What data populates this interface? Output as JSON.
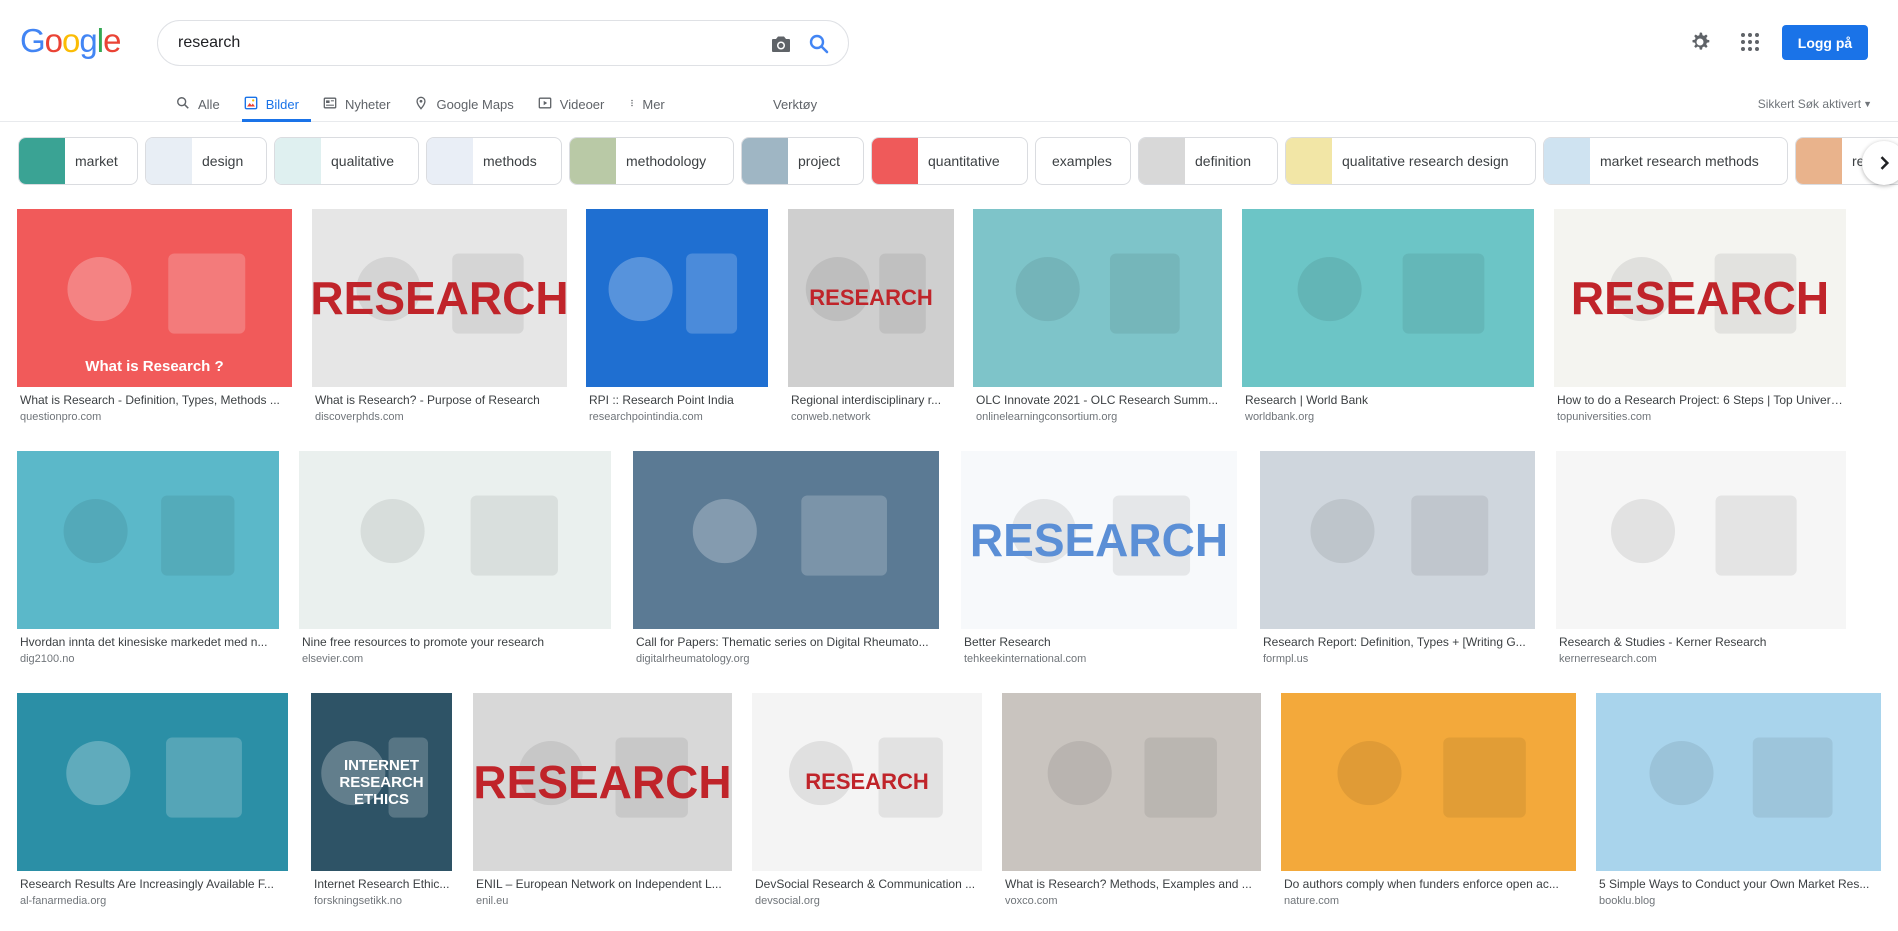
{
  "search": {
    "query": "research"
  },
  "logo": {
    "text": [
      "G",
      "o",
      "o",
      "g",
      "l",
      "e"
    ],
    "colors": [
      "#4285f4",
      "#ea4335",
      "#fbbc05",
      "#4285f4",
      "#34a853",
      "#ea4335"
    ]
  },
  "header": {
    "login_label": "Logg på"
  },
  "tabs": [
    {
      "label": "Alle",
      "icon": "search-icon",
      "active": false
    },
    {
      "label": "Bilder",
      "icon": "image-icon",
      "active": true
    },
    {
      "label": "Nyheter",
      "icon": "news-icon",
      "active": false
    },
    {
      "label": "Google Maps",
      "icon": "map-pin-icon",
      "active": false
    },
    {
      "label": "Videoer",
      "icon": "video-icon",
      "active": false
    },
    {
      "label": "Mer",
      "icon": "more-vert-icon",
      "active": false
    }
  ],
  "tools_label": "Verktøy",
  "safe_search_label": "Sikkert Søk aktivert",
  "chips": [
    {
      "label": "market",
      "color": "#3aa394"
    },
    {
      "label": "design",
      "color": "#e8eef5"
    },
    {
      "label": "qualitative",
      "color": "#dff0f0"
    },
    {
      "label": "methods",
      "color": "#e9eef6"
    },
    {
      "label": "methodology",
      "color": "#b9c9a6"
    },
    {
      "label": "project",
      "color": "#9fb6c4"
    },
    {
      "label": "quantitative",
      "color": "#ef5a5a"
    },
    {
      "label": "examples",
      "color": ""
    },
    {
      "label": "definition",
      "color": "#d8d8d8"
    },
    {
      "label": "qualitative research design",
      "color": "#f2e6a6"
    },
    {
      "label": "market research methods",
      "color": "#cfe3f1"
    },
    {
      "label": "re",
      "color": "#e9b38c"
    }
  ],
  "results": [
    {
      "title": "What is Research - Definition, Types, Methods ...",
      "source": "questionpro.com",
      "color": "#f15a5a",
      "overlay": "What is Research ?"
    },
    {
      "title": "What is Research? - Purpose of Research",
      "source": "discoverphds.com",
      "color": "#e6e6e6",
      "overlay": "RESEARCH"
    },
    {
      "title": "RPI :: Research Point India",
      "source": "researchpointindia.com",
      "color": "#1f6fd1",
      "overlay": ""
    },
    {
      "title": "Regional interdisciplinary r...",
      "source": "conweb.network",
      "color": "#cfcfcf",
      "overlay": "RESEARCH"
    },
    {
      "title": "OLC Innovate 2021 - OLC Research Summ...",
      "source": "onlinelearningconsortium.org",
      "color": "#7ec4c9",
      "overlay": ""
    },
    {
      "title": "Research | World Bank",
      "source": "worldbank.org",
      "color": "#6cc5c6",
      "overlay": ""
    },
    {
      "title": "How to do a Research Project: 6 Steps | Top Universities",
      "source": "topuniversities.com",
      "color": "#f4f4f0",
      "overlay": "RESEARCH"
    },
    {
      "title": "Hvordan innta det kinesiske markedet med n...",
      "source": "dig2100.no",
      "color": "#5bb8c9",
      "overlay": ""
    },
    {
      "title": "Nine free resources to promote your research",
      "source": "elsevier.com",
      "color": "#eaf0ee",
      "overlay": ""
    },
    {
      "title": "Call for Papers: Thematic series on Digital Rheumato...",
      "source": "digitalrheumatology.org",
      "color": "#5b7a94",
      "overlay": ""
    },
    {
      "title": "Better Research",
      "source": "tehkeekinternational.com",
      "color": "#f7f9fb",
      "overlay": "RESEARCH"
    },
    {
      "title": "Research Report: Definition, Types + [Writing G...",
      "source": "formpl.us",
      "color": "#cfd6dd",
      "overlay": ""
    },
    {
      "title": "Research & Studies - Kerner Research",
      "source": "kernerresearch.com",
      "color": "#f6f6f6",
      "overlay": ""
    },
    {
      "title": "Research Results Are Increasingly Available F...",
      "source": "al-fanarmedia.org",
      "color": "#2b8fa6",
      "overlay": ""
    },
    {
      "title": "Internet Research Ethic...",
      "source": "forskningsetikk.no",
      "color": "#2e5366",
      "overlay": "INTERNET RESEARCH ETHICS"
    },
    {
      "title": "ENIL – European Network on Independent L...",
      "source": "enil.eu",
      "color": "#d8d8d8",
      "overlay": "RESEARCH"
    },
    {
      "title": "DevSocial Research & Communication ...",
      "source": "devsocial.org",
      "color": "#f4f4f4",
      "overlay": "RESEARCH"
    },
    {
      "title": "What is Research? Methods, Examples and ...",
      "source": "voxco.com",
      "color": "#c9c4bf",
      "overlay": ""
    },
    {
      "title": "Do authors comply when funders enforce open ac...",
      "source": "nature.com",
      "color": "#f3a93b",
      "overlay": ""
    },
    {
      "title": "5 Simple Ways to Conduct your Own Market Res...",
      "source": "booklu.blog",
      "color": "#a9d4ec",
      "overlay": ""
    }
  ]
}
